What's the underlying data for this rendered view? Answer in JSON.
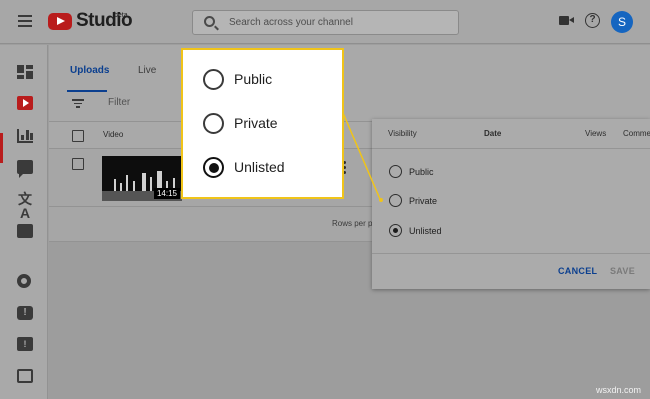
{
  "app": {
    "name": "Studio",
    "badge": "beta"
  },
  "header": {
    "search_placeholder": "Search across your channel",
    "avatar_letter": "S",
    "help_glyph": "?"
  },
  "sidebar": {
    "items": [
      {
        "icon": "dashboard-icon"
      },
      {
        "icon": "videos-icon",
        "active": true
      },
      {
        "icon": "analytics-icon"
      },
      {
        "icon": "comments-icon"
      },
      {
        "icon": "subtitles-icon",
        "glyph": "文A"
      },
      {
        "icon": "audio-library-icon"
      },
      {
        "icon": "settings-icon"
      },
      {
        "icon": "alert-icon",
        "glyph": "!"
      },
      {
        "icon": "feedback-icon",
        "glyph": "!"
      },
      {
        "icon": "creator-studio-classic-icon"
      }
    ]
  },
  "tabs": [
    {
      "label": "Uploads",
      "active": true
    },
    {
      "label": "Live",
      "active": false
    }
  ],
  "filter": {
    "placeholder": "Filter"
  },
  "table": {
    "columns": {
      "video": "Video"
    },
    "rows": [
      {
        "duration": "14:15"
      }
    ],
    "footer": {
      "rows_per_page": "Rows per p"
    }
  },
  "visibility_panel": {
    "columns": [
      "Visibility",
      "Date",
      "Views",
      "Comme"
    ],
    "options": [
      {
        "label": "Public",
        "selected": false
      },
      {
        "label": "Private",
        "selected": false
      },
      {
        "label": "Unlisted",
        "selected": true
      }
    ],
    "cancel_label": "CANCEL",
    "save_label": "SAVE"
  },
  "callout": {
    "options": [
      {
        "label": "Public",
        "selected": false
      },
      {
        "label": "Private",
        "selected": false
      },
      {
        "label": "Unlisted",
        "selected": true
      }
    ]
  },
  "colors": {
    "brand_red": "#b91c1c",
    "accent_blue": "#0b3f8f",
    "callout_border": "#f0c419",
    "avatar_blue": "#1565c0"
  },
  "watermark": "wsxdn.com"
}
